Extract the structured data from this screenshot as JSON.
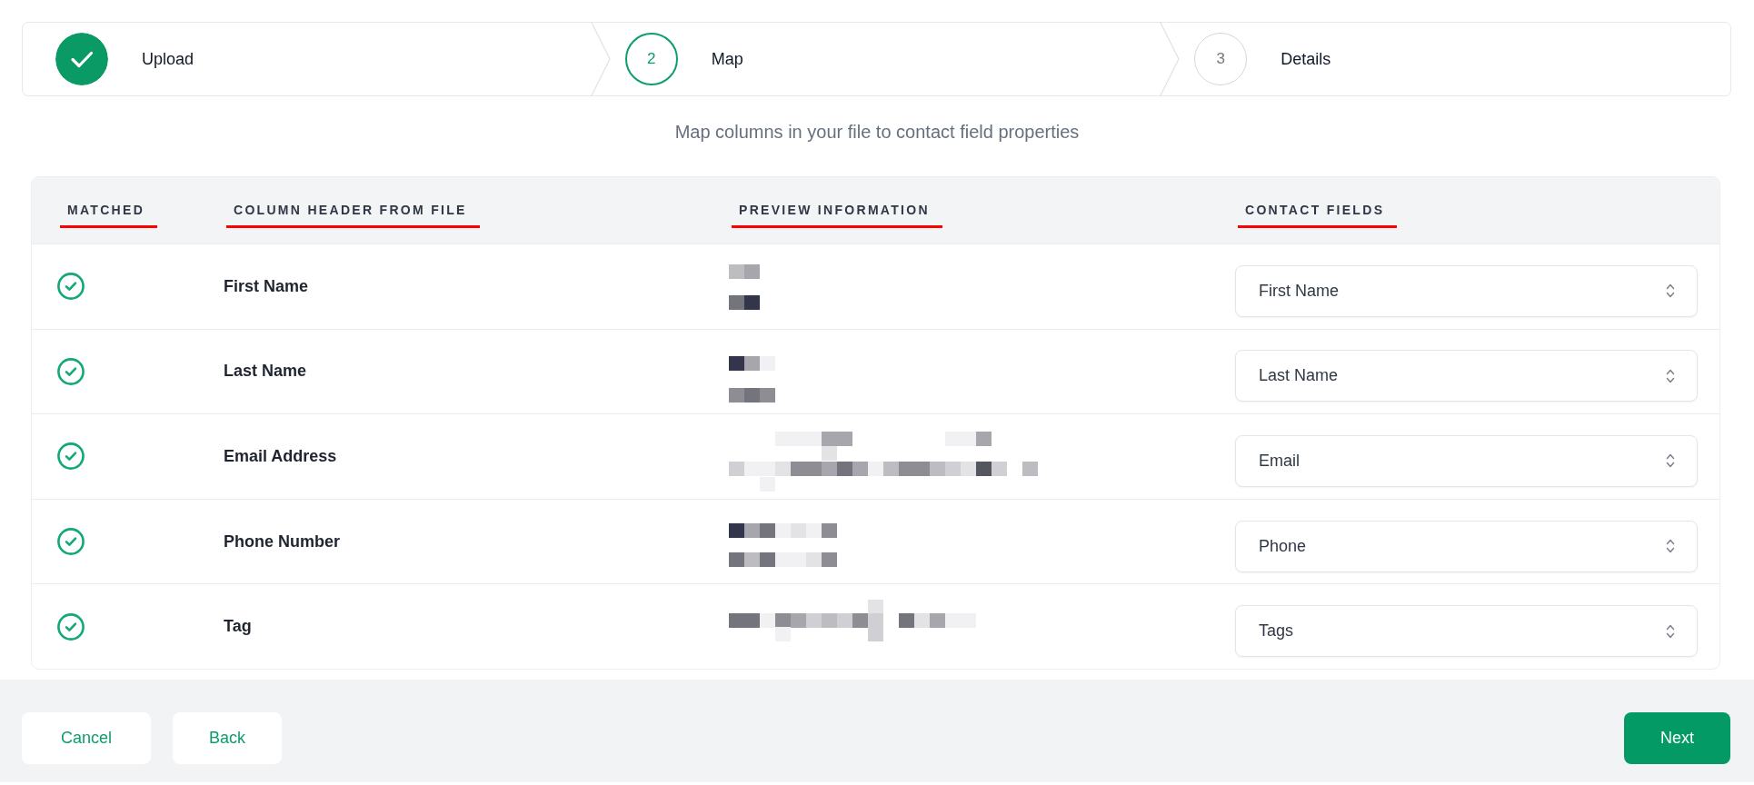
{
  "steps": [
    {
      "label": "Upload",
      "completed": true,
      "current": false
    },
    {
      "number": "2",
      "label": "Map",
      "completed": false,
      "current": true
    },
    {
      "number": "3",
      "label": "Details",
      "completed": false,
      "current": false
    }
  ],
  "subtitle": "Map columns in your file to contact field properties",
  "table": {
    "columns": [
      {
        "label": "MATCHED",
        "underlined": true
      },
      {
        "label": "COLUMN HEADER FROM FILE",
        "underlined": true
      },
      {
        "label": "PREVIEW INFORMATION",
        "underlined": true
      },
      {
        "label": "CONTACT FIELDS",
        "underlined": true
      }
    ],
    "rows": [
      {
        "matched": true,
        "column_header": "First Name",
        "contact_field": "First Name"
      },
      {
        "matched": true,
        "column_header": "Last Name",
        "contact_field": "Last Name"
      },
      {
        "matched": true,
        "column_header": "Email Address",
        "contact_field": "Email"
      },
      {
        "matched": true,
        "column_header": "Phone Number",
        "contact_field": "Phone"
      },
      {
        "matched": true,
        "column_header": "Tag",
        "contact_field": "Tags"
      }
    ]
  },
  "footer": {
    "buttons": [
      {
        "label": "Cancel",
        "kind": "secondary"
      },
      {
        "label": "Back",
        "kind": "secondary"
      },
      {
        "label": "Next",
        "kind": "primary"
      }
    ]
  }
}
